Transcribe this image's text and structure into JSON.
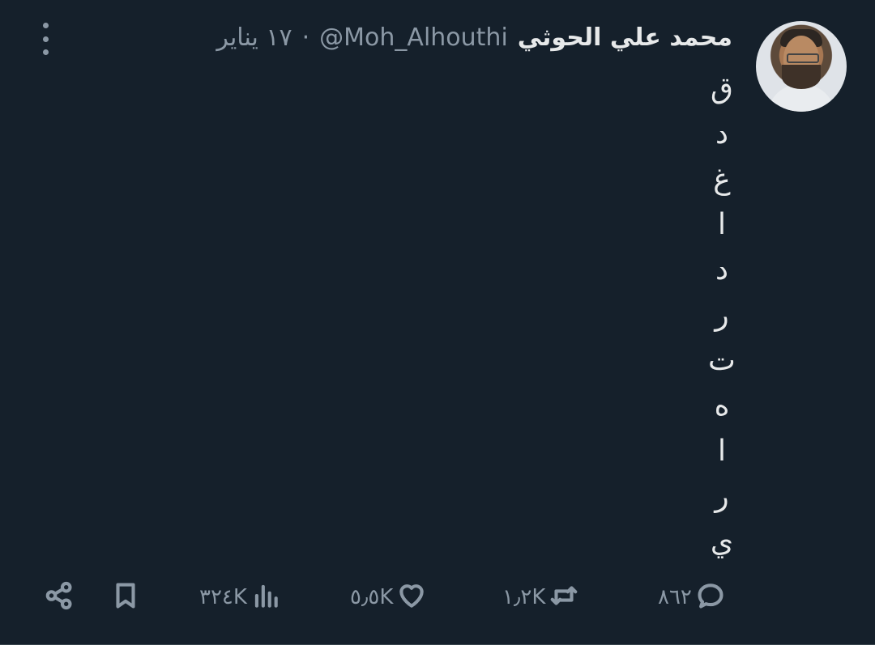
{
  "tweet": {
    "author": {
      "display_name": "محمد علي الحوثي",
      "handle": "@Moh_Alhouthi"
    },
    "separator": "·",
    "time": "١٧ يناير",
    "text_chars": [
      "ق",
      "د",
      "غ",
      "ا",
      "د",
      "ر",
      "ت",
      "ه",
      "ا",
      "ر",
      "ي"
    ],
    "stats": {
      "replies": "٨٦٢",
      "retweets": "١٫٢K",
      "likes": "٥٫٥K",
      "views": "٣٢٤K"
    }
  },
  "icons": {
    "reply": "reply-icon",
    "retweet": "retweet-icon",
    "like": "heart-icon",
    "views": "views-icon",
    "bookmark": "bookmark-icon",
    "share": "share-icon",
    "more": "more-vertical-icon"
  },
  "colors": {
    "background": "#15202b",
    "text": "#e7e9ea",
    "secondary_text": "#8b98a5"
  }
}
